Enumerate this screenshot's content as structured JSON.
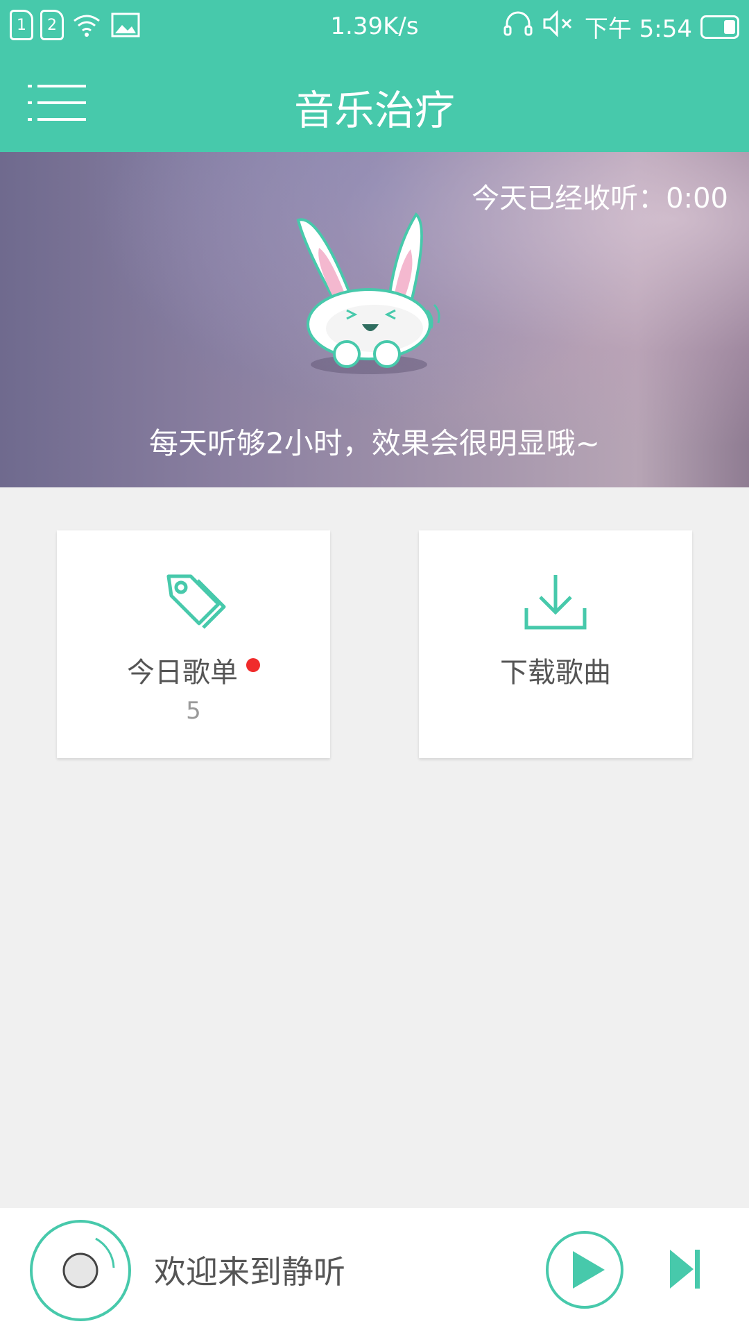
{
  "status_bar": {
    "sim1": "1",
    "sim2": "2",
    "net_speed": "1.39K/s",
    "time": "下午 5:54"
  },
  "app_bar": {
    "title": "音乐治疗"
  },
  "banner": {
    "listened_today": "今天已经收听：0:00",
    "slogan": "每天听够2小时，效果会很明显哦~"
  },
  "cards": [
    {
      "label": "今日歌单",
      "count": "5",
      "has_new_dot": true,
      "icon": "tag-icon"
    },
    {
      "label": "下载歌曲",
      "icon": "download-icon"
    }
  ],
  "player": {
    "welcome_text": "欢迎来到静听"
  },
  "colors": {
    "accent": "#47c9ab",
    "badge": "#f02b2b"
  }
}
